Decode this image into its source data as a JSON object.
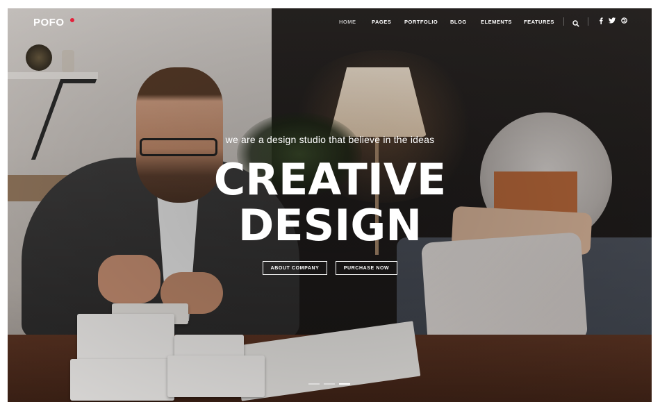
{
  "header": {
    "logo_text": "POFO",
    "logo_accent_color": "#e4203a",
    "nav": [
      {
        "label": "HOME",
        "active": true
      },
      {
        "label": "PAGES",
        "active": false
      },
      {
        "label": "PORTFOLIO",
        "active": false
      },
      {
        "label": "BLOG",
        "active": false
      },
      {
        "label": "ELEMENTS",
        "active": false
      },
      {
        "label": "FEATURES",
        "active": false
      }
    ],
    "icons": [
      "search-icon",
      "facebook-icon",
      "twitter-icon",
      "dribbble-icon"
    ]
  },
  "hero": {
    "tagline": "we are a design studio that believe in the ideas",
    "headline_line1": "CREATIVE",
    "headline_line2": "DESIGN",
    "buttons": {
      "about": "ABOUT COMPANY",
      "purchase": "PURCHASE NOW"
    },
    "slider": {
      "count": 3,
      "active_index": 3
    }
  }
}
